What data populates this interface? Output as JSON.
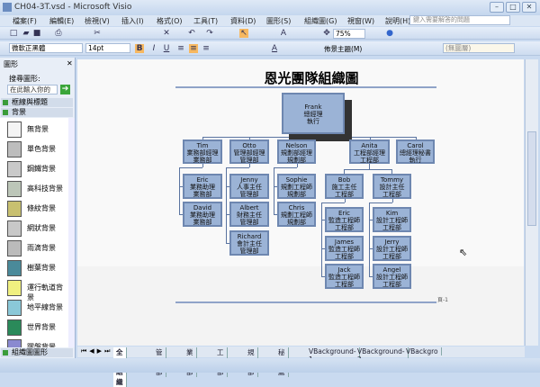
{
  "window": {
    "title": "CH04-3T.vsd - Microsoft Visio",
    "controls": [
      "minimize",
      "maximize",
      "close"
    ]
  },
  "menu": [
    "檔案(F)",
    "編輯(E)",
    "檢視(V)",
    "插入(I)",
    "格式(O)",
    "工具(T)",
    "資料(D)",
    "圖形(S)",
    "組織圖(G)",
    "視窗(W)",
    "說明(H)"
  ],
  "help_placeholder": "鍵入需要解答的問題",
  "toolbar": {
    "zoom": "75%",
    "font": "微軟正黑體",
    "size": "14pt",
    "theme_label": "佈景主題(M)",
    "layer": "(無圖層)"
  },
  "shapes_panel": {
    "title": "圖形",
    "search_label": "搜尋圖形:",
    "search_placeholder": "在此輸入你的",
    "categories": [
      "框線與標題",
      "背景"
    ],
    "items": [
      "無背景",
      "單色背景",
      "鋼鐵背景",
      "高科技背景",
      "條紋背景",
      "網狀背景",
      "雨滴背景",
      "樹葉背景",
      "運行軌道背景",
      "地平線背景",
      "世界背景",
      "躍盤背景",
      "雲朵背景"
    ],
    "bottom_category": "組織圖圖形"
  },
  "chart": {
    "title": "恩光團隊組織圖",
    "page_label": "頁-1",
    "nodes": [
      {
        "id": "frank",
        "lines": [
          "Frank",
          "總經理",
          "執行"
        ]
      },
      {
        "id": "tim",
        "lines": [
          "Tim",
          "業務部經理",
          "業務部"
        ]
      },
      {
        "id": "otto",
        "lines": [
          "Otto",
          "管理部經理",
          "管理部"
        ]
      },
      {
        "id": "nelson",
        "lines": [
          "Nelson",
          "規劃部經理",
          "規劃部"
        ]
      },
      {
        "id": "anita",
        "lines": [
          "Anita",
          "工程部經理",
          "工程部"
        ]
      },
      {
        "id": "carol",
        "lines": [
          "Carol",
          "總經理秘書",
          "執行"
        ]
      },
      {
        "id": "eric1",
        "lines": [
          "Eric",
          "業務助理",
          "業務部"
        ]
      },
      {
        "id": "david",
        "lines": [
          "David",
          "業務助理",
          "業務部"
        ]
      },
      {
        "id": "jenny",
        "lines": [
          "Jenny",
          "人事主任",
          "管理部"
        ]
      },
      {
        "id": "albert",
        "lines": [
          "Albert",
          "財務主任",
          "管理部"
        ]
      },
      {
        "id": "richard",
        "lines": [
          "Richard",
          "會計主任",
          "管理部"
        ]
      },
      {
        "id": "sophie",
        "lines": [
          "Sophie",
          "規劃工程師",
          "規劃部"
        ]
      },
      {
        "id": "chris",
        "lines": [
          "Chris",
          "規劃工程師",
          "規劃部"
        ]
      },
      {
        "id": "bob",
        "lines": [
          "Bob",
          "施工主任",
          "工程部"
        ]
      },
      {
        "id": "tommy",
        "lines": [
          "Tommy",
          "設計主任",
          "工程部"
        ]
      },
      {
        "id": "eric2",
        "lines": [
          "Eric",
          "監造工程師",
          "工程部"
        ]
      },
      {
        "id": "james",
        "lines": [
          "James",
          "監造工程師",
          "工程部"
        ]
      },
      {
        "id": "jack",
        "lines": [
          "Jack",
          "監造工程師",
          "工程部"
        ]
      },
      {
        "id": "kim",
        "lines": [
          "Kim",
          "設計工程師",
          "工程部"
        ]
      },
      {
        "id": "jerry",
        "lines": [
          "Jerry",
          "設計工程師",
          "工程部"
        ]
      },
      {
        "id": "angel",
        "lines": [
          "Angel",
          "設計工程師",
          "工程部"
        ]
      }
    ]
  },
  "page_tabs": [
    "全部組織",
    "管理部",
    "業務部",
    "工程部",
    "規劃部",
    "秘書處",
    "VBackground-1",
    "VBackground-2",
    "VBackgro"
  ]
}
